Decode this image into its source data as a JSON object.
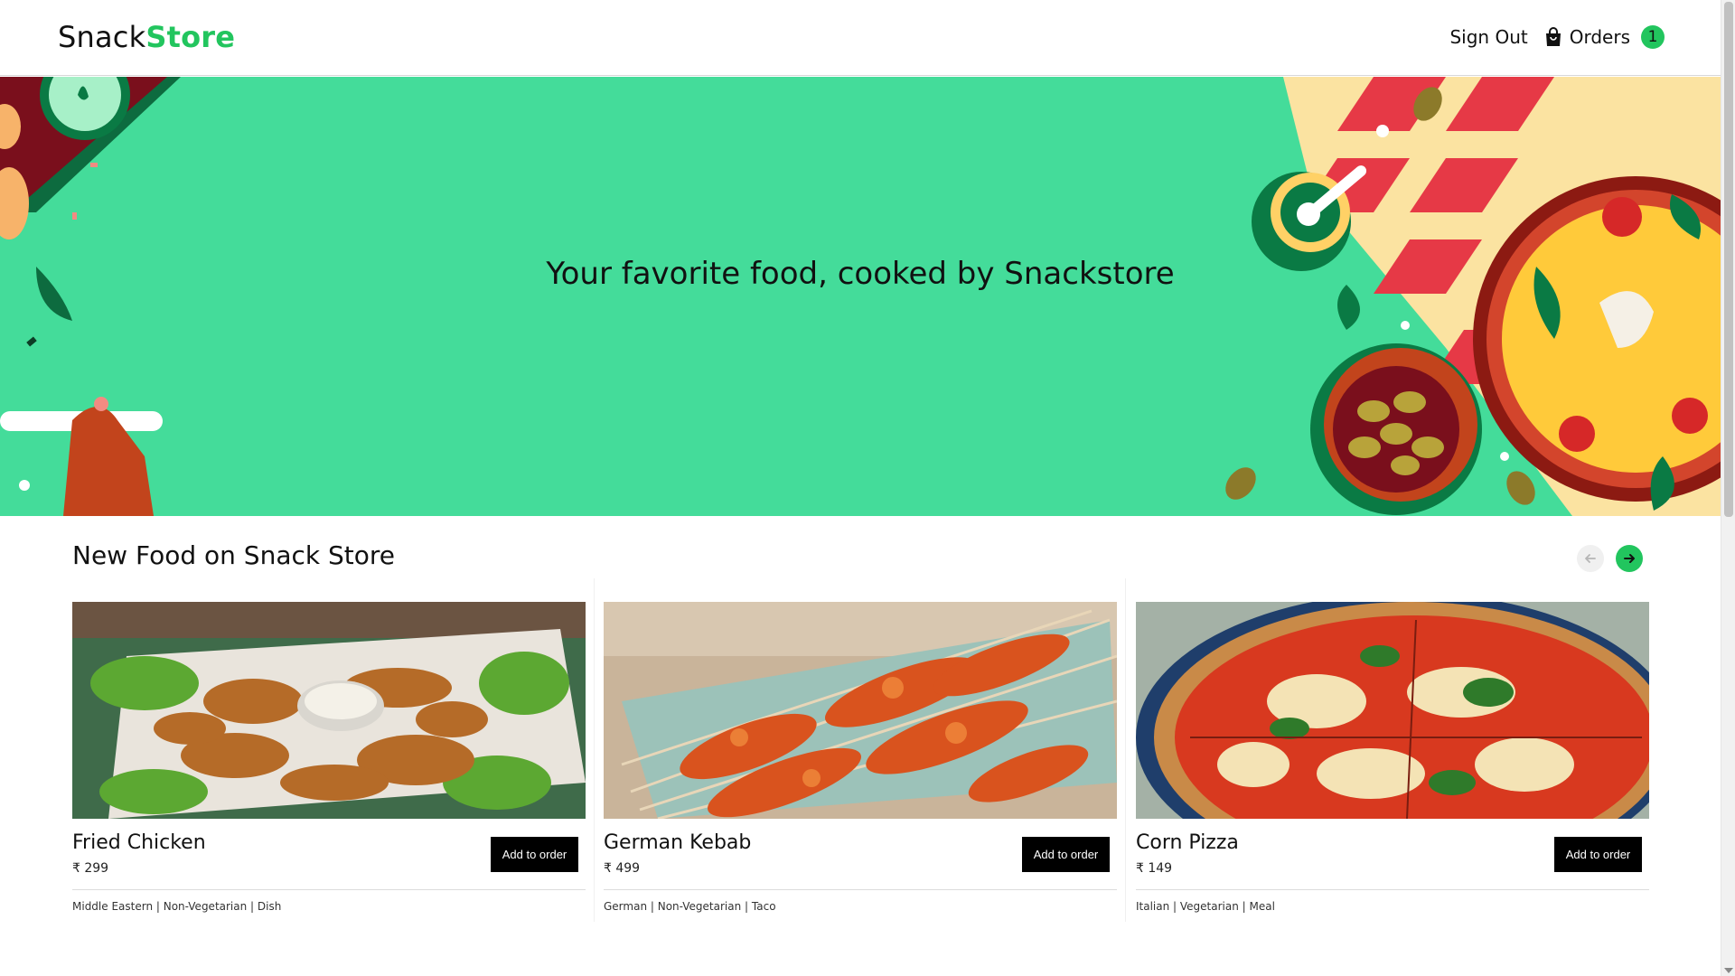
{
  "header": {
    "logo_part1": "Snack",
    "logo_part2": "Store",
    "sign_out": "Sign Out",
    "orders_label": "Orders",
    "orders_count": "1"
  },
  "hero": {
    "title": "Your favorite food, cooked by Snackstore",
    "background_color": "#44dc9a"
  },
  "section": {
    "title": "New Food on Snack Store",
    "prev_icon": "arrow-left-icon",
    "next_icon": "arrow-right-icon"
  },
  "foods": [
    {
      "name": "Fried Chicken",
      "price": "₹ 299",
      "tags": "Middle Eastern | Non-Vegetarian | Dish",
      "button": "Add to order"
    },
    {
      "name": "German Kebab",
      "price": "₹ 499",
      "tags": "German | Non-Vegetarian | Taco",
      "button": "Add to order"
    },
    {
      "name": "Corn Pizza",
      "price": "₹ 149",
      "tags": "Italian | Vegetarian | Meal",
      "button": "Add to order"
    }
  ],
  "colors": {
    "accent": "#22c55e",
    "button": "#000000"
  }
}
